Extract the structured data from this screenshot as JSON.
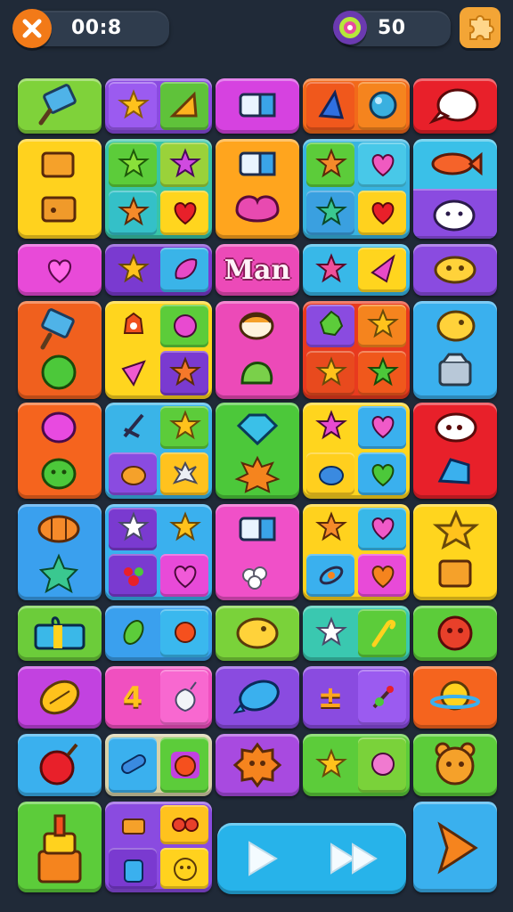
{
  "hud": {
    "close_icon": "close-x-icon",
    "timer": "00:8",
    "coin_icon": "gem-coin-icon",
    "score": "50",
    "puzzle_icon": "puzzle-piece-icon"
  },
  "board": {
    "word_tile": "Man",
    "number_tile": "4",
    "symbol_tile": "±"
  },
  "controls": {
    "play_icon": "play-icon",
    "fast_forward_icon": "fast-forward-icon",
    "next_icon": "arrow-right-icon"
  },
  "colors": {
    "background": "#202a38",
    "hud_pill": "#2f3c4d",
    "close_button": "#f07a1a",
    "puzzle_button": "#f2a433",
    "play_bar": "#27b3ea"
  }
}
